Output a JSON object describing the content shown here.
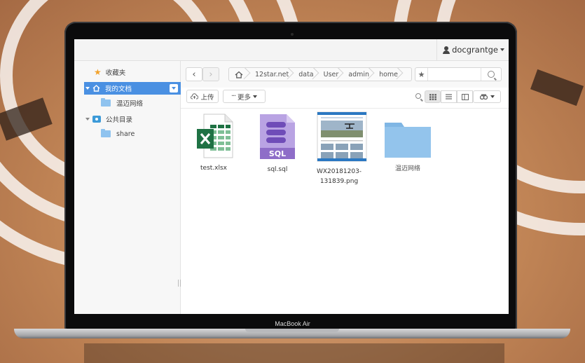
{
  "device": {
    "label": "MacBook Air"
  },
  "user": {
    "name": "docgrantge"
  },
  "sidebar": {
    "items": [
      {
        "label": "收藏夹",
        "icon": "star-icon"
      },
      {
        "label": "我的文档",
        "icon": "home-icon",
        "active": true
      },
      {
        "label": "温迈网络",
        "icon": "folder-icon"
      },
      {
        "label": "公共目录",
        "icon": "public-folder-icon"
      },
      {
        "label": "share",
        "icon": "folder-icon"
      }
    ]
  },
  "nav": {
    "back": "‹",
    "forward": "›",
    "breadcrumb": [
      "12star.net",
      "data",
      "User",
      "admin",
      "home"
    ]
  },
  "search": {
    "placeholder": ""
  },
  "toolbar": {
    "upload_label": "上传",
    "more_label": "更多",
    "zoom_icon": "zoom-icon",
    "view_icons": [
      "grid-view-icon",
      "list-view-icon",
      "split-view-icon",
      "settings-icon"
    ]
  },
  "files": [
    {
      "name": "test.xlsx",
      "type": "excel"
    },
    {
      "name": "sql.sql",
      "type": "sql"
    },
    {
      "name": "WX20181203-131839.png",
      "type": "image"
    },
    {
      "name": "温迈网络",
      "type": "folder"
    }
  ],
  "colors": {
    "accent": "#4a90e2",
    "folder": "#8fc3ef",
    "excel": "#1f7244",
    "sql": "#8e6dc8"
  }
}
